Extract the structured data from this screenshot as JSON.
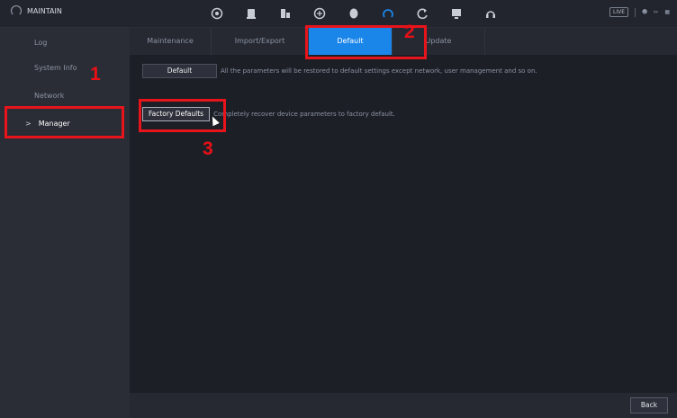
{
  "topbar": {
    "title": "MAINTAIN",
    "icons": [
      "camera-icon",
      "record-icon",
      "event-icon",
      "network-icon",
      "storage-icon",
      "maintain-icon",
      "refresh-icon",
      "display-icon",
      "headset-icon"
    ],
    "active_icon_index": 5,
    "live_label": "LIVE",
    "accent": "#1b86ea"
  },
  "sidebar": {
    "items": [
      {
        "label": "Log"
      },
      {
        "label": "System Info"
      },
      {
        "label": "Network"
      },
      {
        "label": "Manager",
        "chevron": ">"
      }
    ],
    "active_index": 3
  },
  "tabs": [
    {
      "label": "Maintenance"
    },
    {
      "label": "Import/Export"
    },
    {
      "label": "Default"
    },
    {
      "label": "Update"
    }
  ],
  "active_tab_index": 2,
  "default_row": {
    "button_label": "Default",
    "description": "All the parameters will be restored to default settings except network, user management and so on."
  },
  "factory_row": {
    "button_label": "Factory Defaults",
    "description": "Completely recover device parameters to factory default."
  },
  "footer": {
    "back_label": "Back"
  },
  "annotations": {
    "step1": "1",
    "step2": "2",
    "step3": "3",
    "color": "#e8141c"
  }
}
